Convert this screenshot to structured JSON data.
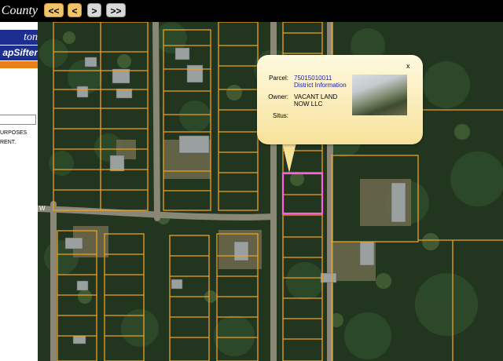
{
  "header": {
    "logo_text": "County",
    "buttons": [
      {
        "label": "<<",
        "action": "first"
      },
      {
        "label": "<",
        "action": "previous"
      },
      {
        "label": ">",
        "action": "next"
      },
      {
        "label": ">>",
        "action": "last"
      }
    ]
  },
  "sidebar": {
    "town_label": "ton",
    "mapsifter_label": "apSifter",
    "search_value": "",
    "note_line1": "URPOSES",
    "note_line2": "RENT."
  },
  "map": {
    "road_label": "W",
    "layer": "aerial imagery with parcel boundaries",
    "parcel_line_color": "#f0a020",
    "selected_parcel_color": "#ff5fd8"
  },
  "popup": {
    "close_label": "x",
    "parcel_label": "Parcel:",
    "parcel_value": "75015010011",
    "district_link": "District Information",
    "owner_label": "Owner:",
    "owner_line1": "VACANT LAND",
    "owner_line2": "NOW LLC",
    "situs_label": "Situs:",
    "situs_value": ""
  }
}
